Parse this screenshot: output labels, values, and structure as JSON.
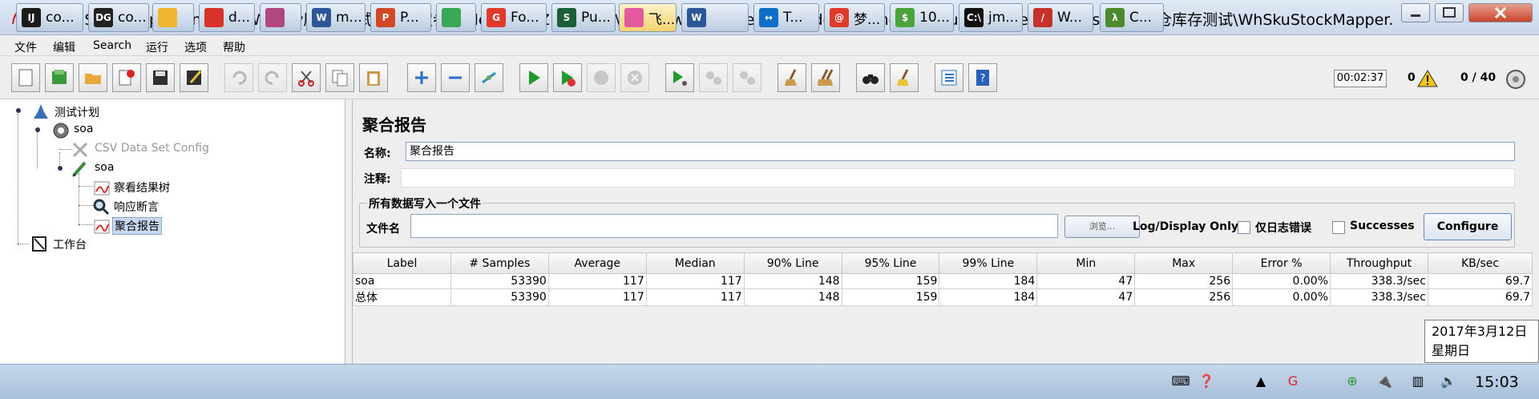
{
  "window": {
    "title": "WhSkuStockMapper.increaseWhQty压测_测试一个固定参数-dev.jmx (Z:\\backup\\studio\\work_lib\\feiniu_lib\\development_document\\pressure_test\\多地多仓库存测试\\WhSkuStockMapper.increas..."
  },
  "menu": [
    "文件",
    "编辑",
    "Search",
    "运行",
    "选项",
    "帮助"
  ],
  "toolbar": {
    "timer": "00:02:37",
    "warning_count": "0",
    "threads": "0 / 40"
  },
  "tree": {
    "test_plan": "测试计划",
    "thread_group": "soa",
    "csv_config": "CSV Data Set Config",
    "sampler": "soa",
    "view_results": "察看结果树",
    "assertion": "响应断言",
    "aggregate": "聚合报告",
    "workbench": "工作台"
  },
  "panel": {
    "title": "聚合报告",
    "name_label": "名称:",
    "name_value": "聚合报告",
    "comment_label": "注释:",
    "comment_value": "",
    "file_group_title": "所有数据写入一个文件",
    "filename_label": "文件名",
    "filename_value": "",
    "browse_button": "浏览...",
    "log_display_label": "Log/Display Only:",
    "errors_only_label": "仅日志错误",
    "successes_label": "Successes",
    "configure_button": "Configure"
  },
  "table": {
    "headers": [
      "Label",
      "# Samples",
      "Average",
      "Median",
      "90% Line",
      "95% Line",
      "99% Line",
      "Min",
      "Max",
      "Error %",
      "Throughput",
      "KB/sec"
    ],
    "rows": [
      [
        "soa",
        "53390",
        "117",
        "117",
        "148",
        "159",
        "184",
        "47",
        "256",
        "0.00%",
        "338.3/sec",
        "69.7"
      ],
      [
        "总体",
        "53390",
        "117",
        "117",
        "148",
        "159",
        "184",
        "47",
        "256",
        "0.00%",
        "338.3/sec",
        "69.7"
      ]
    ]
  },
  "tooltip": {
    "date": "2017年3月12日",
    "weekday": "星期日"
  },
  "taskbar": {
    "items": [
      {
        "label": "co...",
        "icon": "IJ",
        "color": "#1b1b1b"
      },
      {
        "label": "co...",
        "icon": "DG",
        "color": "#222222"
      },
      {
        "label": "",
        "icon": "",
        "color": "#f2b632"
      },
      {
        "label": "d...",
        "icon": "",
        "color": "#d8332b"
      },
      {
        "label": "",
        "icon": "",
        "color": "#b0477e"
      },
      {
        "label": "m...",
        "icon": "W",
        "color": "#2b5797"
      },
      {
        "label": "P...",
        "icon": "P",
        "color": "#d24726"
      },
      {
        "label": "",
        "icon": "",
        "color": "#3aa757"
      },
      {
        "label": "Fo...",
        "icon": "G",
        "color": "#e03a2a"
      },
      {
        "label": "Pu...",
        "icon": "S",
        "color": "#1d5e3a"
      },
      {
        "label": "飞...",
        "icon": "",
        "color": "#e55a9e"
      },
      {
        "label": "",
        "icon": "W",
        "color": "#2b5797"
      },
      {
        "label": "T...",
        "icon": "↔",
        "color": "#0e6fc7"
      },
      {
        "label": "梦...",
        "icon": "@",
        "color": "#e03a2a"
      },
      {
        "label": "10...",
        "icon": "$",
        "color": "#4aa33b"
      },
      {
        "label": "jm...",
        "icon": "C:\\",
        "color": "#111111"
      },
      {
        "label": "W...",
        "icon": "/",
        "color": "#c4322a"
      },
      {
        "label": "C...",
        "icon": "λ",
        "color": "#4d8a2b"
      }
    ],
    "clock": "15:03"
  }
}
